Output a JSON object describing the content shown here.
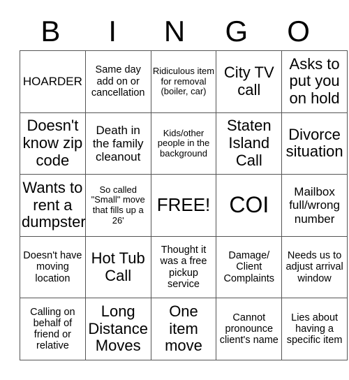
{
  "card": {
    "header_letters": [
      "B",
      "I",
      "N",
      "G",
      "O"
    ],
    "rows": [
      [
        {
          "text": "HOARDER",
          "size": "m"
        },
        {
          "text": "Same day add on or cancellation",
          "size": "s"
        },
        {
          "text": "Ridiculous item for removal (boiler, car)",
          "size": "xs"
        },
        {
          "text": "City TV call",
          "size": "l"
        },
        {
          "text": "Asks to put you on hold",
          "size": "l"
        }
      ],
      [
        {
          "text": "Doesn't know zip code",
          "size": "l"
        },
        {
          "text": "Death in the family cleanout",
          "size": "m"
        },
        {
          "text": "Kids/other people in the background",
          "size": "xs"
        },
        {
          "text": "Staten Island Call",
          "size": "l"
        },
        {
          "text": "Divorce situation",
          "size": "l"
        }
      ],
      [
        {
          "text": "Wants to rent a dumpster",
          "size": "l"
        },
        {
          "text": "So called \"Small\" move that fills up a 26'",
          "size": "xs"
        },
        {
          "text": "FREE!",
          "size": "xl"
        },
        {
          "text": "COI",
          "size": "xxl"
        },
        {
          "text": "Mailbox full/wrong number",
          "size": "m"
        }
      ],
      [
        {
          "text": "Doesn't have moving location",
          "size": "s"
        },
        {
          "text": "Hot Tub Call",
          "size": "l"
        },
        {
          "text": "Thought it was a free pickup service",
          "size": "s"
        },
        {
          "text": "Damage/ Client Complaints",
          "size": "s"
        },
        {
          "text": "Needs us to adjust arrival window",
          "size": "s"
        }
      ],
      [
        {
          "text": "Calling on behalf of friend or relative",
          "size": "s"
        },
        {
          "text": "Long Distance Moves",
          "size": "l"
        },
        {
          "text": "One item move",
          "size": "l"
        },
        {
          "text": "Cannot pronounce client's name",
          "size": "s"
        },
        {
          "text": "Lies about having a specific item",
          "size": "s"
        }
      ]
    ]
  }
}
